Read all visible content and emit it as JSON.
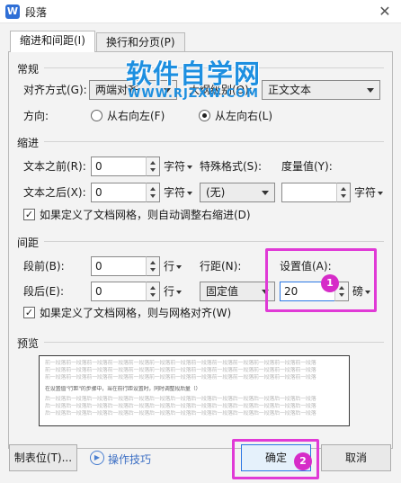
{
  "window": {
    "title": "段落",
    "app_icon_letter": "W",
    "close_glyph": "✕"
  },
  "tabs": [
    {
      "label": "缩进和间距(I)"
    },
    {
      "label": "换行和分页(P)"
    }
  ],
  "general": {
    "section_title": "常规",
    "alignment_label": "对齐方式(G):",
    "alignment_value": "两端对齐",
    "outline_label": "大纲级别(O):",
    "outline_value": "正文文本",
    "direction_label": "方向:",
    "rtl_label": "从右向左(F)",
    "ltr_label": "从左向右(L)",
    "direction_selected": "ltr"
  },
  "indent": {
    "section_title": "缩进",
    "before_text_label": "文本之前(R):",
    "before_text_value": "0",
    "before_text_unit": "字符",
    "special_label": "特殊格式(S):",
    "special_value": "(无)",
    "measure_label": "度量值(Y):",
    "measure_value": "",
    "measure_unit": "字符",
    "after_text_label": "文本之后(X):",
    "after_text_value": "0",
    "after_text_unit": "字符",
    "grid_checkbox_label": "如果定义了文档网格，则自动调整右缩进(D)",
    "grid_checkbox_checked": true
  },
  "spacing": {
    "section_title": "间距",
    "before_label": "段前(B):",
    "before_value": "0",
    "before_unit": "行",
    "after_label": "段后(E):",
    "after_value": "0",
    "after_unit": "行",
    "line_spacing_label": "行距(N):",
    "line_spacing_value": "固定值",
    "setting_label": "设置值(A):",
    "setting_value": "20",
    "setting_unit": "磅",
    "grid_checkbox_label": "如果定义了文档网格，则与网格对齐(W)",
    "grid_checkbox_checked": true
  },
  "preview": {
    "section_title": "预览",
    "line_before": "前一段落前一段落前一段落前一段落前一段落前一段落前一段落前一段落前一段落前一段落前一段落前一段落前一段落",
    "line_sample": "在设置值\"行距\"的步骤中，当在前行距设置时，同时调整段后量（）",
    "line_after": "后一段落后一段落后一段落后一段落后一段落后一段落后一段落后一段落后一段落后一段落后一段落后一段落后一段落"
  },
  "footer": {
    "tabs_button": "制表位(T)...",
    "tips_icon": "play-circle-icon",
    "tips_label": "操作技巧",
    "ok_button": "确定",
    "cancel_button": "取消"
  },
  "annotations": {
    "badge_1": "1",
    "badge_2": "2",
    "highlight_color": "#e03ad6"
  },
  "watermark": {
    "title": "软件自学网",
    "url": "WWW.RJZXW.COM"
  }
}
